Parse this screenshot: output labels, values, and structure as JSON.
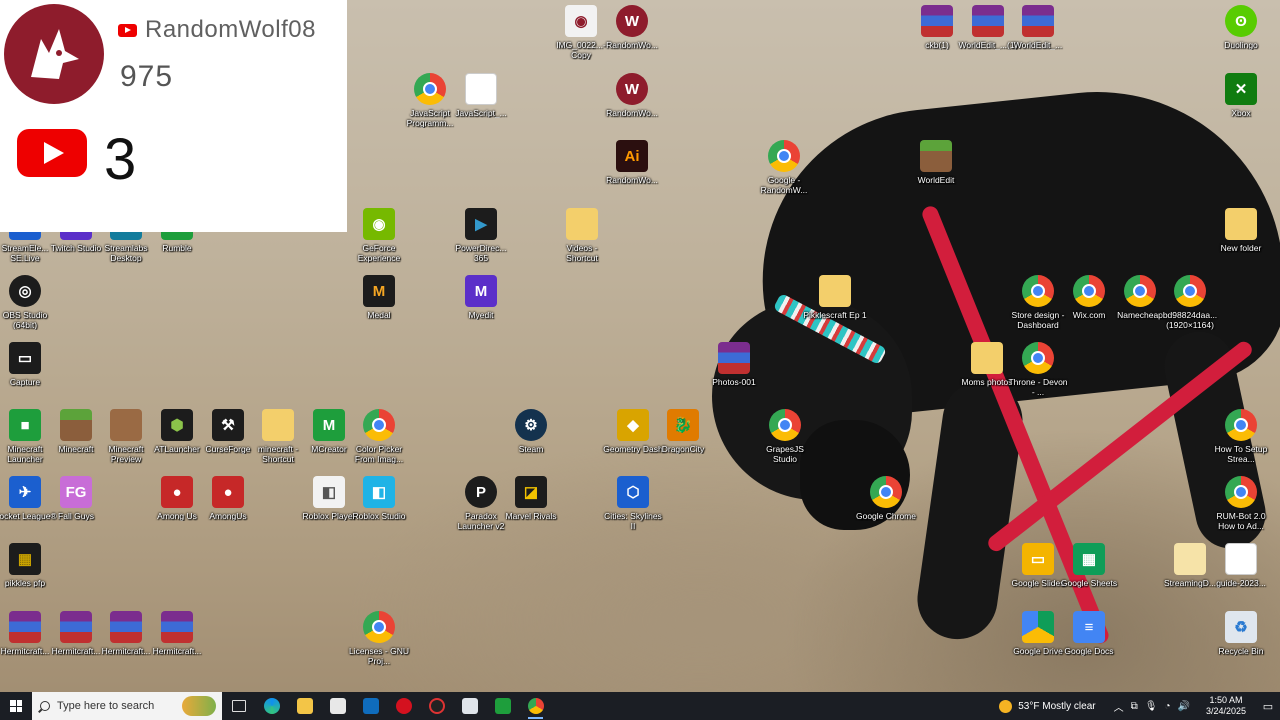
{
  "overlay": {
    "channel_name": "RandomWolf08",
    "subscriber_count": "975",
    "live_count": "3"
  },
  "icons": {
    "img": "IMG_0022...- Copy",
    "rw1": "RandomWo...",
    "rar1": "ckb(1)",
    "rar2": "WorldEdit_...(1)",
    "rar3": "WorldEdit_...",
    "duolingo": "Duolingo",
    "jsprog": "JavaScript Programm...",
    "jsfile": "JavaScript_...",
    "rw2": "RandomWo...",
    "xbox": "Xbox",
    "ai": "RandomWo...",
    "google_rw": "Google - RandomW...",
    "worldedit": "WorldEdit",
    "streamelements": "StreamEle... SE.Live",
    "twitch": "Twitch Studio",
    "streamlabs": "Streamlabs Desktop",
    "rumble": "Rumble",
    "geforce": "GeForce Experience",
    "powerdirector": "PowerDirec... 365",
    "videos": "Videos - Shortcut",
    "newfolder": "New folder",
    "obs": "OBS Studio (64bit)",
    "medal": "Medal",
    "myedit": "Myedit",
    "pikklescraft": "Pikklescraft Ep 1",
    "store": "Store design - Dashboard",
    "wix": "Wix.com",
    "namecheap": "Namecheap",
    "bd98": "bd98824daa... (1920×1164)",
    "capture": "Capture",
    "photos": "Photos-001",
    "moms": "Moms photos",
    "throne": "Throne - Devon - ...",
    "mclauncher": "Minecraft Launcher",
    "minecraft": "Minecraft",
    "mcpreview": "Minecraft Preview",
    "atlauncher": "ATLauncher",
    "curseforge": "CurseForge",
    "mcshortcut": "minecraft - Shortcut",
    "mcreator": "MCreator",
    "colorpicker": "Color Picker From Imag...",
    "steam": "Steam",
    "geometry": "Geometry Dash",
    "dragoncity": "DragonCity",
    "grapesjs": "GrapesJS Studio",
    "howto": "How To Setup Strea...",
    "rocket": "Rocket League®",
    "fallguys": "Fall Guys",
    "amongus1": "Among Us",
    "amongus2": "AmongUs",
    "robloxplayer": "Roblox Player",
    "robloxstudio": "Roblox Studio",
    "paradox": "Paradox Launcher v2",
    "marvel": "Marvel Rivals",
    "cities": "Cities: Skylines II",
    "chrome": "Google Chrome",
    "rumbot": "RUM-Bot 2.0 How to Ad...",
    "pikklespfp": "pikkles pfp",
    "slides": "Google Slides",
    "sheets": "Google Sheets",
    "streamingd": "StreamingD...",
    "guide": "guide-2023...",
    "hc1": "Hermitcraft...",
    "hc2": "Hermitcraft...",
    "hc3": "Hermitcraft...",
    "hc4": "Hermitcraft...",
    "licenses": "Licenses - GNU Proj...",
    "drive": "Google Drive",
    "docs": "Google Docs",
    "recycle": "Recycle Bin"
  },
  "taskbar": {
    "search_placeholder": "Type here to search",
    "weather": "53°F  Mostly clear",
    "time": "1:50 AM",
    "date": "3/24/2025"
  }
}
